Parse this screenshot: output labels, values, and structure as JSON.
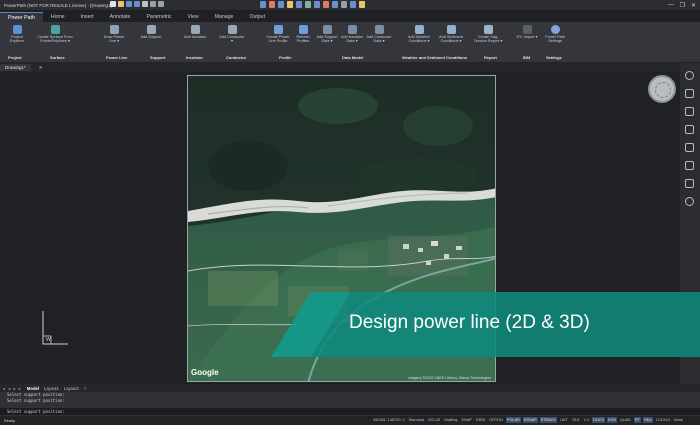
{
  "window": {
    "title": "PowerPath (NOT FOR RESALE License) - [Drawing1]",
    "controls": [
      "—",
      "❐",
      "✕"
    ]
  },
  "ribbon_tabs": [
    "Power Path",
    "Home",
    "Insert",
    "Annotate",
    "Parametric",
    "View",
    "Manage",
    "Output"
  ],
  "ribbon": {
    "buttons": [
      {
        "label": "Project Explorer"
      },
      {
        "label": "Create Surface From Points/Polylines ▾"
      },
      {
        "label": "Draw Power Line ▾"
      },
      {
        "label": "Add Support"
      },
      {
        "label": "Add Insulator"
      },
      {
        "label": "Add Conductor ▾"
      },
      {
        "label": "Create Power Line Profile"
      },
      {
        "label": "Refresh Profiles"
      },
      {
        "label": "Add Support Data ▾"
      },
      {
        "label": "Add Insulator Data ▾"
      },
      {
        "label": "Add Conductor Data ▾"
      },
      {
        "label": "Add Weather Conditions ▾"
      },
      {
        "label": "Add Sediment Conditions ▾"
      },
      {
        "label": "Create Sag-Tension Report ▾"
      },
      {
        "label": "IFC Import ▾"
      },
      {
        "label": "Power Path Settings"
      }
    ],
    "groups": [
      "Project",
      "Surface",
      "Power Line",
      "Support",
      "Insulator",
      "Conductor",
      "Profile",
      "Data Model",
      "Weather and Sediment Conditions",
      "Report",
      "BIM",
      "Settings"
    ]
  },
  "document_tab": {
    "name": "Drawing1*",
    "close": "✕"
  },
  "map": {
    "watermark": "Google",
    "attribution": "Imagery ©2020 CNES / Airbus, Maxar Technologies"
  },
  "banner": {
    "text": "Design power line (2D & 3D)",
    "color": "#0f8a7c"
  },
  "ucs": {
    "axis_label": "W"
  },
  "layout_tabs": {
    "arrows": "◂ ◂ ▸ ▸",
    "tabs": [
      "Model",
      "Layout1",
      "Layout2"
    ],
    "add": "+"
  },
  "command_line": {
    "history": [
      "Select support position:",
      "Select support position:"
    ],
    "prompt": "Select support position:"
  },
  "status": {
    "ready": "Ready",
    "items": [
      "492381, 148700, 0",
      "Standard",
      "ISO-25",
      "Drafting",
      "SNAP",
      "GRID",
      "ORTHO",
      "POLAR",
      "ESNAP",
      "STRACK",
      "LWT",
      "TILE",
      "1:1",
      "DUCS",
      "DYN",
      "QUAD",
      "RT",
      "HKA",
      "LOCKUI",
      "None"
    ]
  },
  "colors": {
    "accent": "#4f88d8",
    "ribbon_bg": "#34363b",
    "canvas_bg": "#202124"
  }
}
